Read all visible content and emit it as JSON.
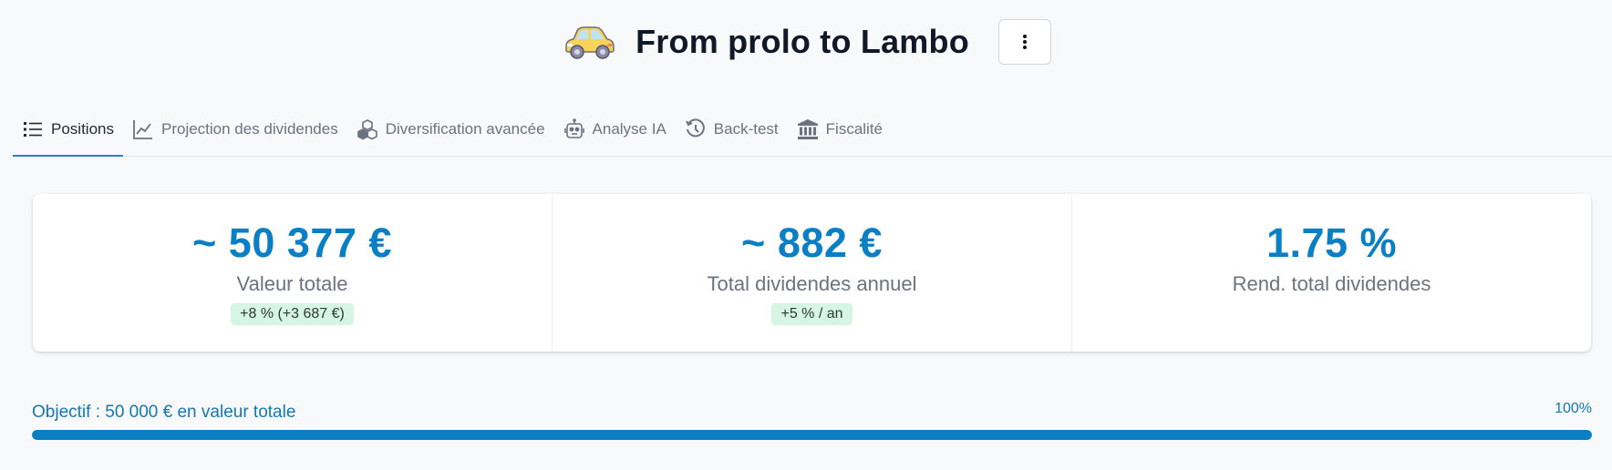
{
  "header": {
    "title": "From prolo to Lambo",
    "icon": "car-icon",
    "menu_icon": "vertical-dots-icon"
  },
  "tabs": [
    {
      "label": "Positions",
      "icon": "list-icon",
      "active": true
    },
    {
      "label": "Projection des dividendes",
      "icon": "line-chart-icon",
      "active": false
    },
    {
      "label": "Diversification avancée",
      "icon": "cubes-icon",
      "active": false
    },
    {
      "label": "Analyse IA",
      "icon": "robot-icon",
      "active": false
    },
    {
      "label": "Back-test",
      "icon": "history-icon",
      "active": false
    },
    {
      "label": "Fiscalité",
      "icon": "bank-icon",
      "active": false
    }
  ],
  "stats": [
    {
      "value": "~ 50 377 €",
      "label": "Valeur totale",
      "badge": "+8 % (+3 687 €)"
    },
    {
      "value": "~ 882 €",
      "label": "Total dividendes annuel",
      "badge": "+5 % / an"
    },
    {
      "value": "1.75 %",
      "label": "Rend. total dividendes",
      "badge": ""
    }
  ],
  "goal": {
    "label": "Objectif : 50 000 € en valeur totale",
    "percent_text": "100%",
    "progress": 1.0
  },
  "colors": {
    "accent": "#0b7fc4",
    "tab_underline": "#2b7bd8",
    "badge_bg": "#d6f5e3"
  }
}
